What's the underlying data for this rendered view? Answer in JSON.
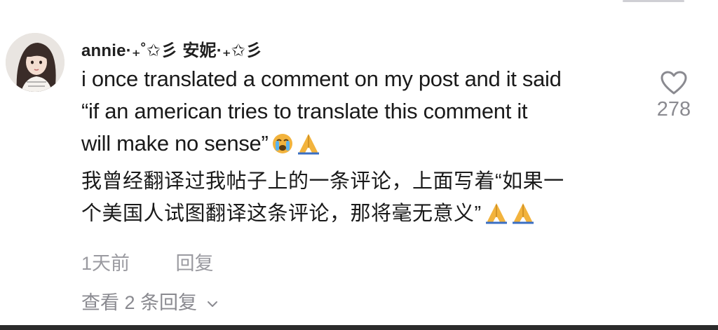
{
  "comment": {
    "username": "annie·₊˚✩彡 安妮·₊✩彡",
    "text_en": [
      "i once translated a comment on my post and it said",
      "“if an american tries to translate this comment it",
      "will make no sense”"
    ],
    "text_zh": [
      "我曾经翻译过我帖子上的一条评论，上面写着“如果一",
      "个美国人试图翻译这条评论，那将毫无意义”"
    ],
    "emoji_en": [
      "crying-face-emoji",
      "folded-hands-emoji"
    ],
    "emoji_zh": [
      "folded-hands-emoji",
      "folded-hands-emoji"
    ],
    "likes": "278",
    "time": "1天前",
    "reply_label": "回复",
    "view_replies_label": "查看 2 条回复"
  },
  "icons": {
    "like": "heart-outline-icon",
    "expand": "chevron-down-icon"
  },
  "colors": {
    "text": "#1a1a1a",
    "muted": "#9a9aa0",
    "like": "#8a8a90",
    "emoji": "#f2b33d"
  }
}
